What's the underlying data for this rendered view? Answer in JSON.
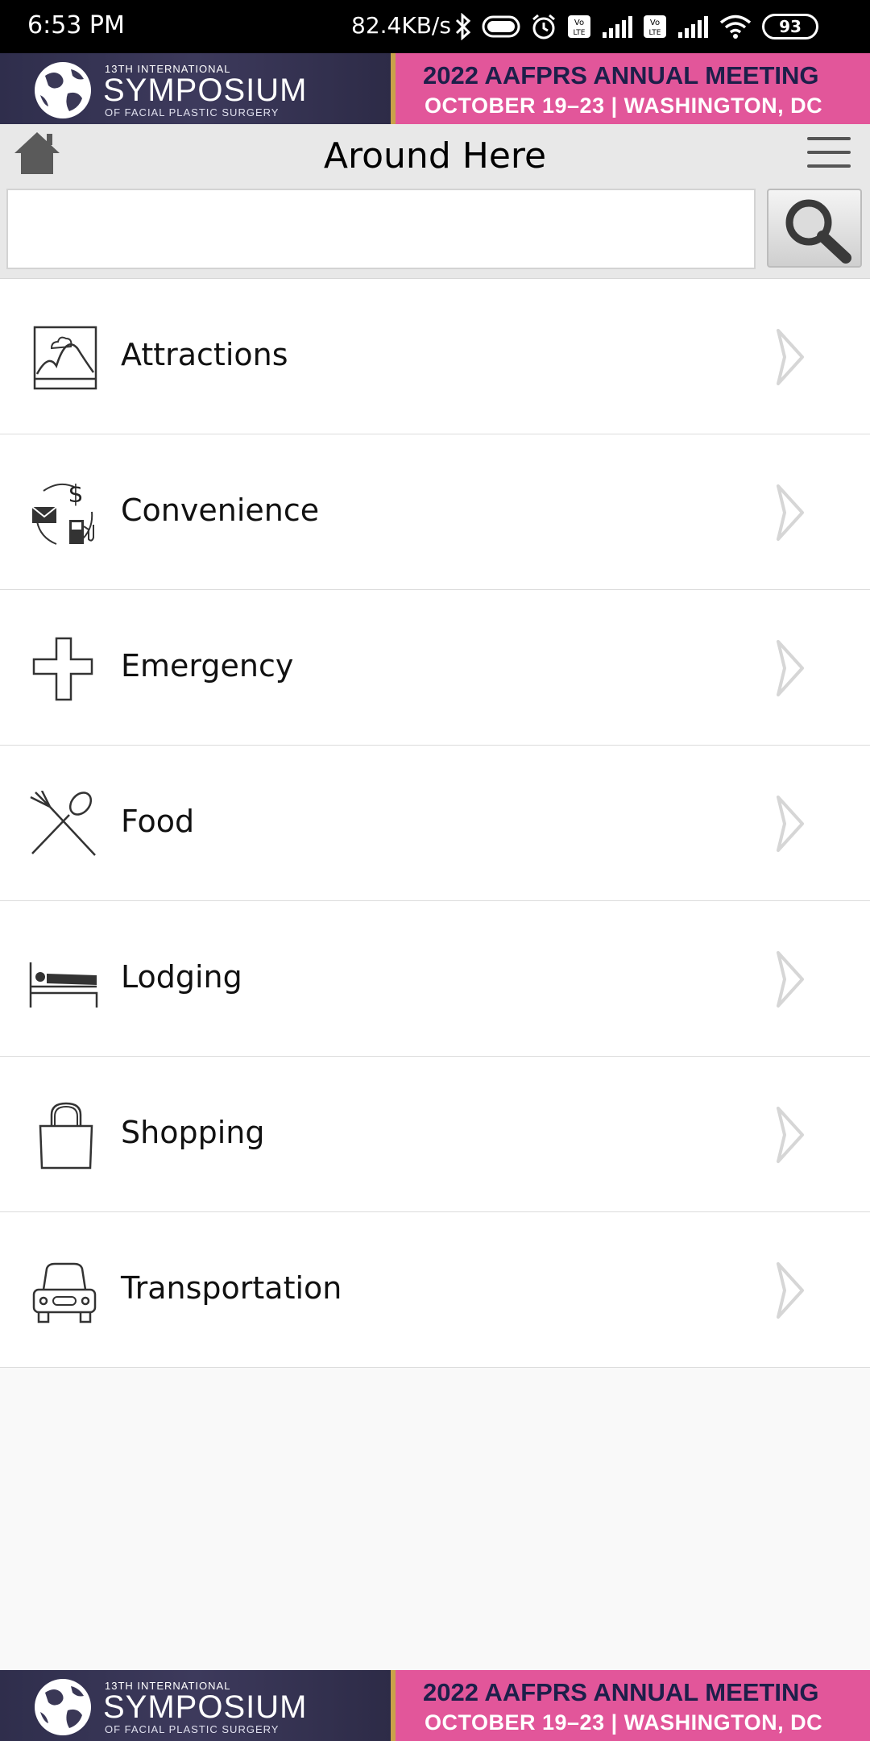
{
  "status_bar": {
    "time": "6:53 PM",
    "speed": "82.4KB/s",
    "battery": "93",
    "icons": [
      "bluetooth-icon",
      "pill-toggle-icon",
      "alarm-icon",
      "volte-icon",
      "signal-icon",
      "volte-icon",
      "signal-icon",
      "wifi-icon",
      "battery-icon"
    ]
  },
  "banner": {
    "symposium_small": "13TH INTERNATIONAL",
    "symposium_big": "SYMPOSIUM",
    "symposium_sub": "OF FACIAL PLASTIC SURGERY",
    "meeting_title": "2022 AAFPRS ANNUAL MEETING",
    "meeting_sub": "OCTOBER 19–23  |  WASHINGTON, DC",
    "colors": {
      "left": "#3a3856",
      "right": "#e2569a",
      "accent": "#c9a24a"
    }
  },
  "header": {
    "title": "Around Here",
    "home_icon": "home-icon",
    "menu_icon": "hamburger-icon",
    "search_icon": "magnifier-icon"
  },
  "search": {
    "value": "",
    "placeholder": ""
  },
  "categories": [
    {
      "label": "Attractions",
      "icon": "landscape-picture-icon"
    },
    {
      "label": "Convenience",
      "icon": "mail-dollar-fuel-icon"
    },
    {
      "label": "Emergency",
      "icon": "medical-cross-icon"
    },
    {
      "label": "Food",
      "icon": "fork-spoon-icon"
    },
    {
      "label": "Lodging",
      "icon": "bed-icon"
    },
    {
      "label": "Shopping",
      "icon": "shopping-bag-icon"
    },
    {
      "label": "Transportation",
      "icon": "car-icon"
    }
  ]
}
